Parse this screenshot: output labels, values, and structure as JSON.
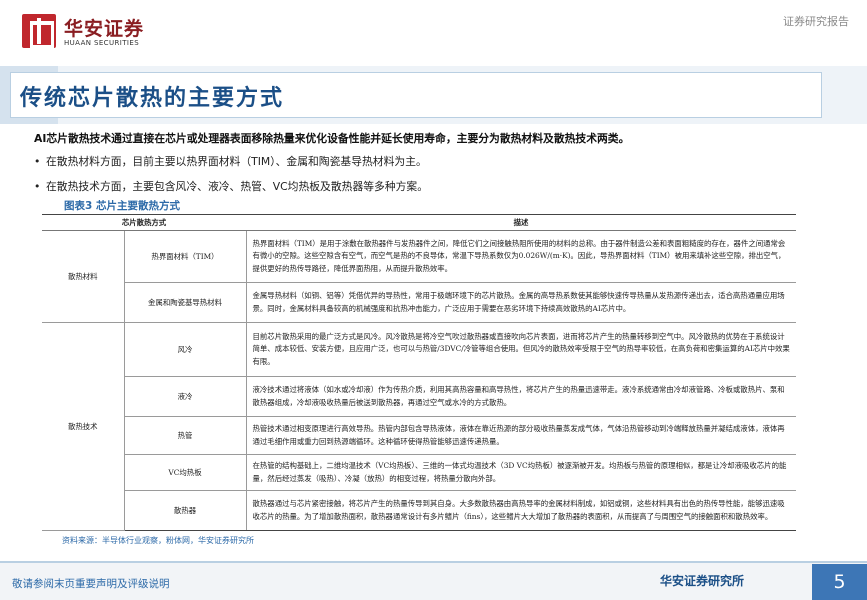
{
  "header": {
    "logo_cn": "华安证券",
    "logo_en": "HUAAN SECURITIES",
    "report_type": "证券研究报告"
  },
  "title": "传统芯片散热的主要方式",
  "intro": {
    "lead": "AI芯片散热技术通过直接在芯片或处理器表面移除热量来优化设备性能并延长使用寿命，主要分为散热材料及散热技术两类。",
    "bullets": [
      "在散热材料方面，目前主要以热界面材料（TIM）、金属和陶瓷基导热材料为主。",
      "在散热技术方面，主要包含风冷、液冷、热管、VC均热板及散热器等多种方案。"
    ],
    "bullet_symbol": "•"
  },
  "figure_title": "图表3 芯片主要散热方式",
  "table": {
    "headers": [
      "芯片散热方式",
      "",
      "描述"
    ],
    "groups": [
      {
        "name": "散热材料",
        "rows": [
          {
            "sub": "热界面材料（TIM）",
            "desc": "热界面材料（TIM）是用于涂敷在散热器件与发热器件之间，降低它们之间接触热阻所使用的材料的总称。由于器件制造公差和表面粗糙度的存在，器件之间通常会有微小的空隙。这些空隙含有空气，而空气是热的不良导体，常温下导热系数仅为0.026W/(m·K)。因此，导热界面材料（TIM）被用来填补这些空隙，排出空气，提供更好的热传导路径，降低界面热阻，从而提升散热效率。"
          },
          {
            "sub": "金属和陶瓷基导热材料",
            "desc": "金属导热材料（如铜、铝等）凭借优异的导热性，常用于极端环境下的芯片散热。金属的高导热系数使其能够快速传导热量从发热源传递出去，适合高热通量应用场景。同时，金属材料具备较高的机械强度和抗热冲击能力，广泛应用于需要在恶劣环境下持续高效散热的AI芯片中。"
          }
        ]
      },
      {
        "name": "散热技术",
        "rows": [
          {
            "sub": "风冷",
            "desc": "目前芯片散热采用的最广泛方式是风冷。风冷散热是将冷空气吹过散热器或直接吹向芯片表面，进而将芯片产生的热量转移到空气中。风冷散热的优势在于系统设计简单、成本较低、安装方便，且应用广泛，也可以与热管/3DVC/冷管等组合使用。但风冷的散热效率受限于空气的热导率较低，在高负荷和密集运算的AI芯片中效果有限。"
          },
          {
            "sub": "液冷",
            "desc": "液冷技术通过将液体（如水或冷却液）作为传热介质，利用其高热容量和高导热性，将芯片产生的热量迅速带走。液冷系统通常由冷却液管路、冷板或散热片、泵和散热器组成，冷却液吸收热量后被送到散热器，再通过空气或水冷的方式散热。"
          },
          {
            "sub": "热管",
            "desc": "热管技术通过相变原理进行高效导热。热管内部包含导热液体，液体在靠近热源的部分吸收热量蒸发成气体，气体沿热管移动到冷端释放热量并凝结成液体，液体再通过毛细作用或重力回到热源端循环。这种循环使得热管能够迅速传递热量。"
          },
          {
            "sub": "VC均热板",
            "desc": "在热管的结构基础上，二维均温技术（VC均热板）、三维的一体式均温技术（3D VC均热板）被逐渐被开发。均热板与热管的原理相似，都是让冷却液吸收芯片的能量，然后经过蒸发（吸热）、冷凝（放热）的相变过程，将热量分散向外部。"
          },
          {
            "sub": "散热器",
            "desc": "散热器通过与芯片紧密接触，将芯片产生的热量传导到其自身。大多数散热器由高热导率的金属材料制成，如铝或铜，这些材料具有出色的热传导性能，能够迅速吸收芯片的热量。为了增加散热面积，散热器通常设计有多片鳍片（fins），这些鳍片大大增加了散热器的表面积，从而提高了与周围空气的接触面积和散热效率。"
          }
        ]
      }
    ]
  },
  "source": "资料来源：半导体行业观察，粉体网，华安证券研究所",
  "footer": {
    "disclaimer": "敬请参阅末页重要声明及评级说明",
    "institute": "华安证券研究所",
    "page": "5"
  },
  "colors": {
    "title_blue": "#1b4f87",
    "accent_blue": "#2d6aa8",
    "brand_red": "#c0272d",
    "page_badge": "#3d76b6"
  }
}
